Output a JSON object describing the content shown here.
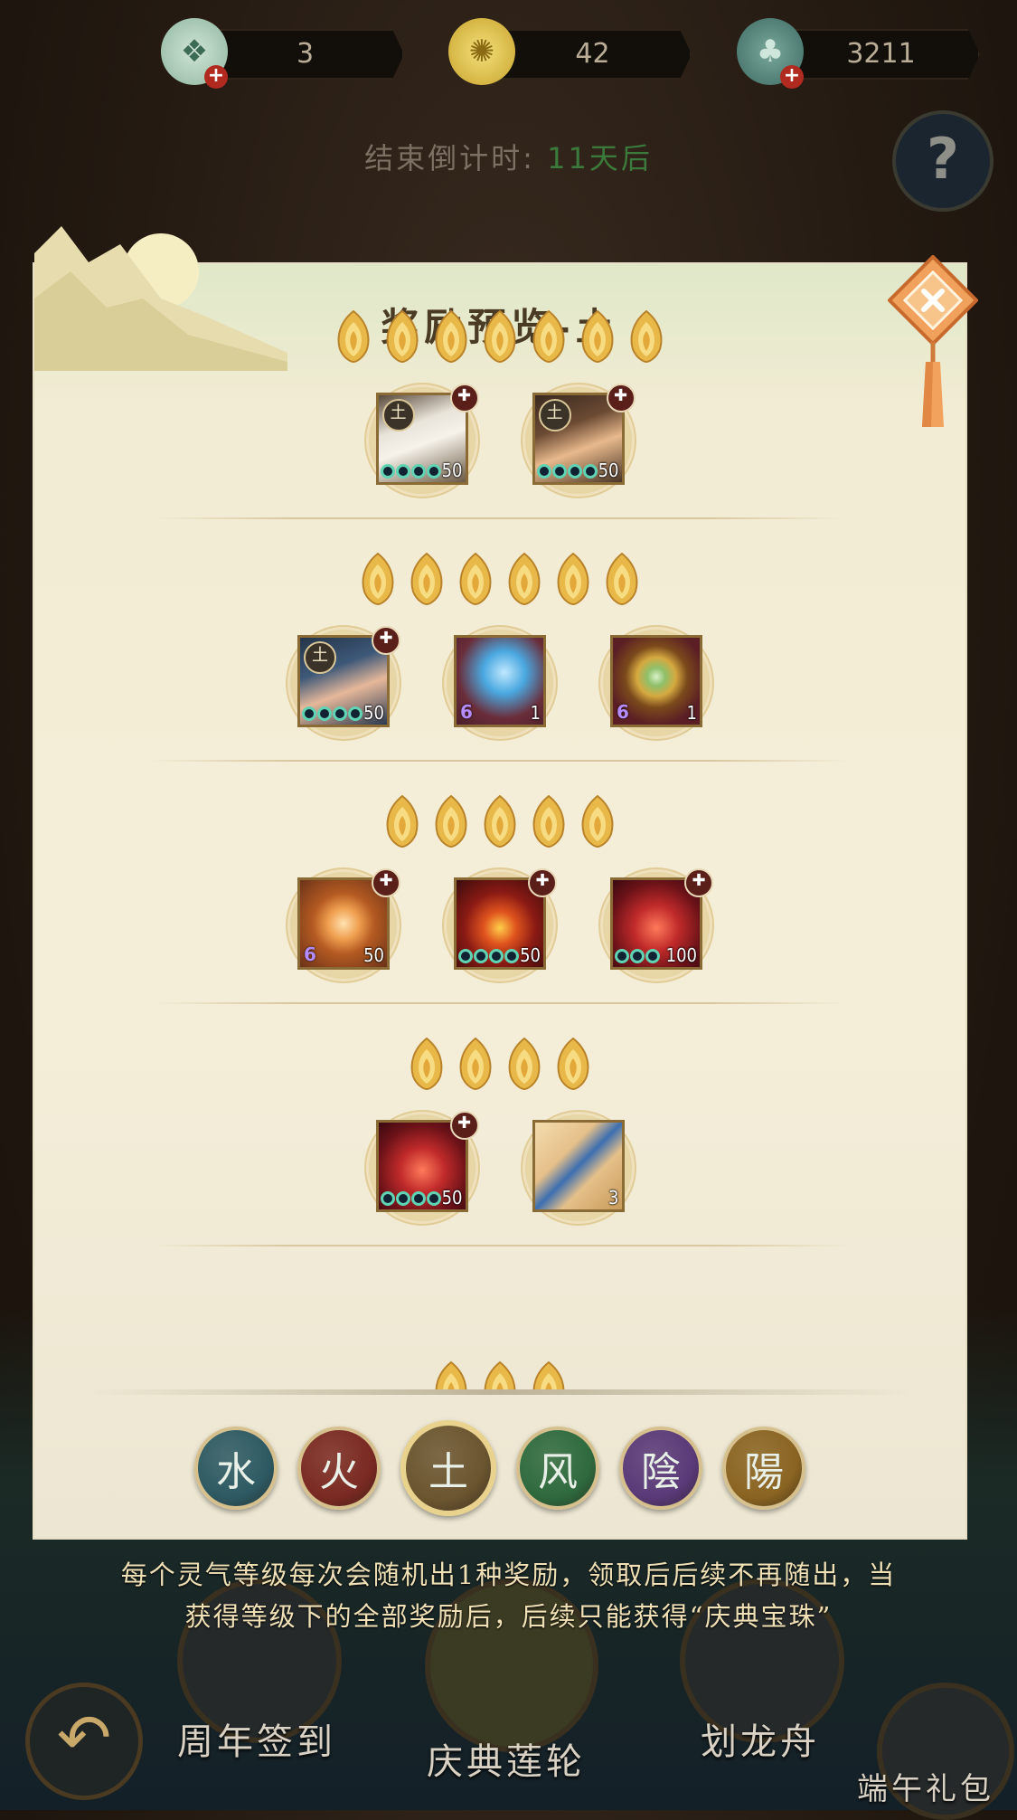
{
  "currencies": [
    {
      "name": "jade-token",
      "value": "3"
    },
    {
      "name": "gold-coin",
      "value": "42"
    },
    {
      "name": "shell-pouch",
      "value": "3211"
    }
  ],
  "countdown": {
    "label": "结束倒计时:",
    "value": "11天后"
  },
  "help": {
    "label": "?"
  },
  "panel": {
    "title": "奖励预览-土",
    "tiers": [
      {
        "gems": 7,
        "items": [
          {
            "kind": "portrait-white-hair",
            "elem": "土",
            "beads": 4,
            "qty": "50"
          },
          {
            "kind": "portrait-brown-hair",
            "elem": "土",
            "beads": 4,
            "qty": "50"
          }
        ]
      },
      {
        "gems": 6,
        "items": [
          {
            "kind": "portrait-hooded",
            "elem": "土",
            "beads": 4,
            "qty": "50"
          },
          {
            "kind": "ice-relic",
            "level": "6",
            "qty": "1"
          },
          {
            "kind": "jade-brooch",
            "level": "6",
            "qty": "1"
          }
        ]
      },
      {
        "gems": 5,
        "items": [
          {
            "kind": "flame-sigil",
            "level": "6",
            "qty": "50"
          },
          {
            "kind": "red-mask",
            "beads": 4,
            "qty": "50"
          },
          {
            "kind": "crimson-mask",
            "beads": 3,
            "qty": "100"
          }
        ]
      },
      {
        "gems": 4,
        "items": [
          {
            "kind": "crimson-mask",
            "beads": 4,
            "qty": "50"
          },
          {
            "kind": "talisman",
            "qty": "3"
          }
        ]
      }
    ],
    "partial_gems": 3,
    "elements": [
      {
        "label": "水",
        "color": "#2e5a63",
        "active": false
      },
      {
        "label": "火",
        "color": "#7a2a22",
        "active": false
      },
      {
        "label": "土",
        "color": "#6b5530",
        "active": true
      },
      {
        "label": "风",
        "color": "#2f6a3e",
        "active": false
      },
      {
        "label": "陰",
        "color": "#5a3a78",
        "active": false
      },
      {
        "label": "陽",
        "color": "#8a6422",
        "active": false
      }
    ]
  },
  "footnote": {
    "line1": "每个灵气等级每次会随机出1种奖励，领取后后续不再随出，当",
    "line2": "获得等级下的全部奖励后，后续只能获得“庆典宝珠”"
  },
  "nav": {
    "items": [
      {
        "label": "周年签到"
      },
      {
        "label": "庆典莲轮"
      },
      {
        "label": "划龙舟"
      },
      {
        "label": "端午礼包"
      }
    ]
  }
}
